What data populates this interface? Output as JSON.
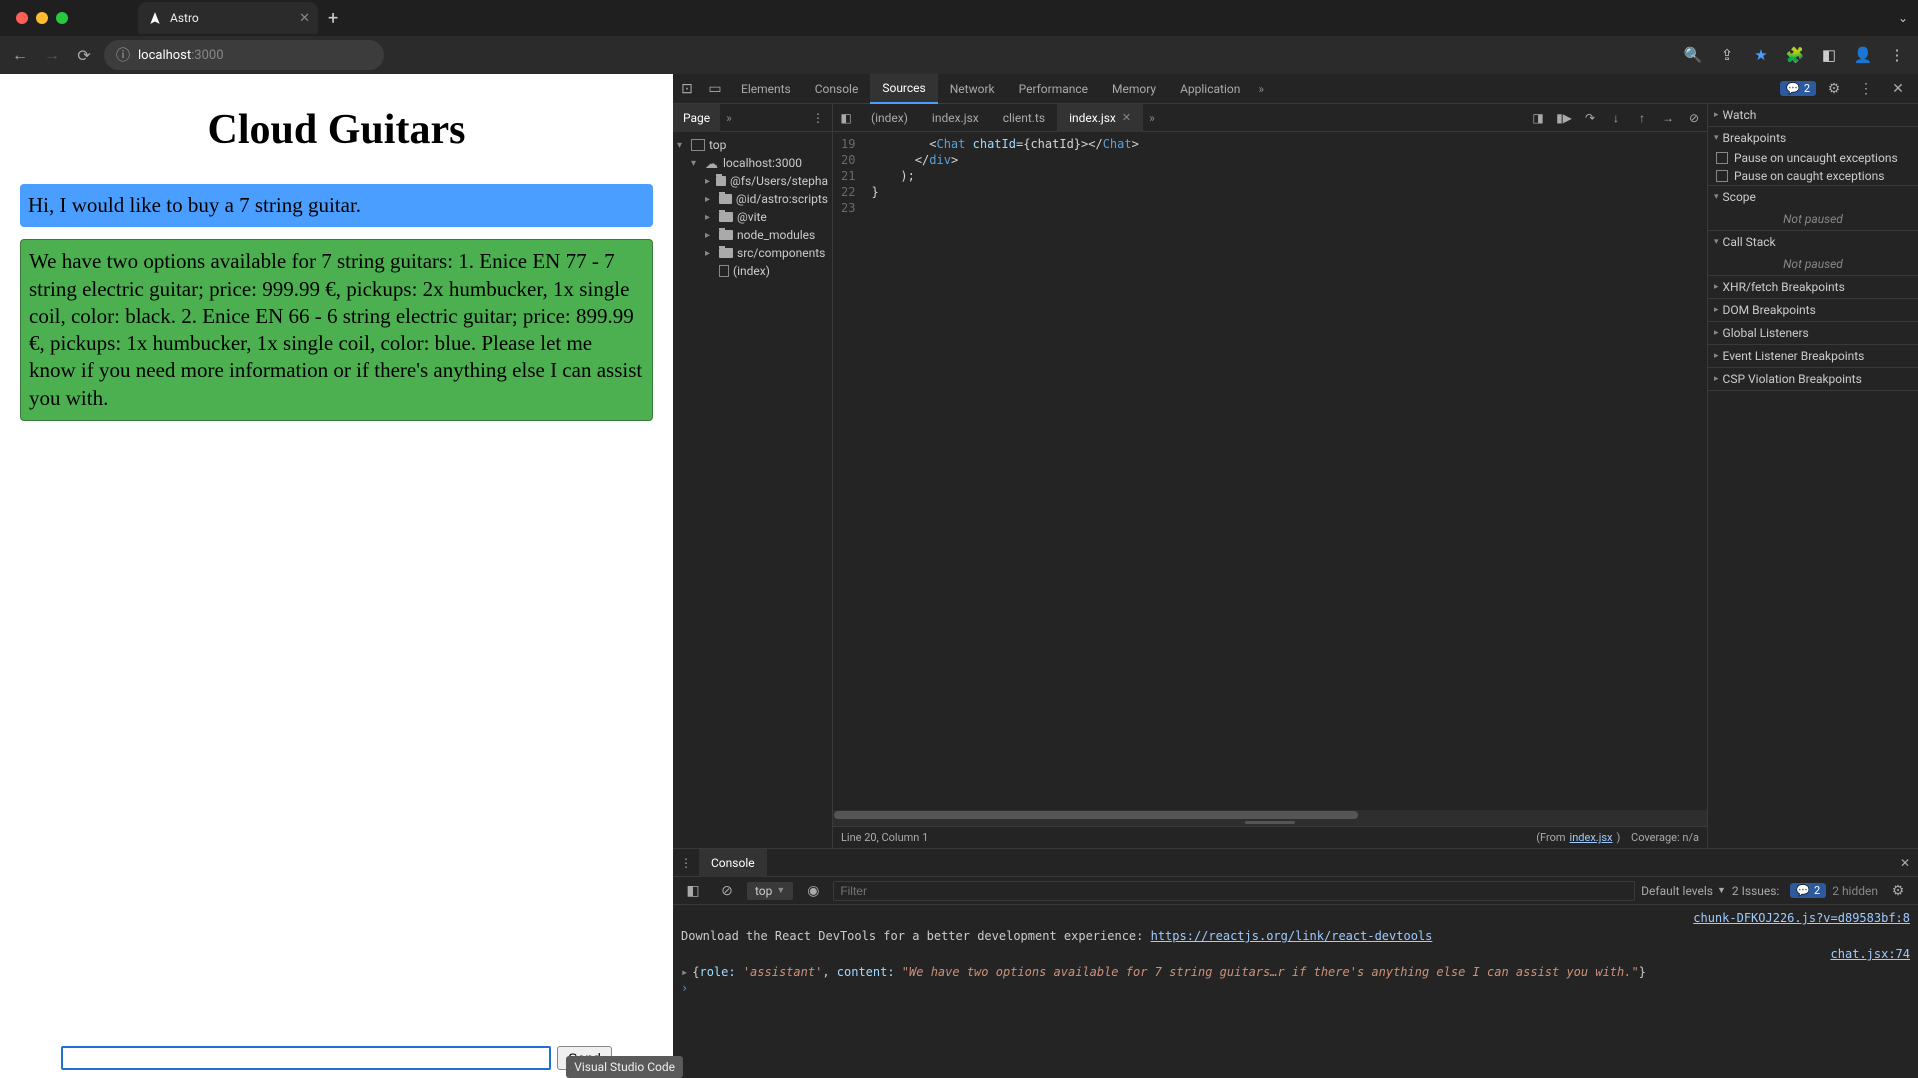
{
  "browser": {
    "tab_title": "Astro",
    "url_host": "localhost",
    "url_port": ":3000"
  },
  "page": {
    "heading": "Cloud Guitars",
    "messages": [
      {
        "role": "user",
        "text": "Hi, I would like to buy a 7 string guitar."
      },
      {
        "role": "assistant",
        "text": "We have two options available for 7 string guitars: 1. Enice EN 77 - 7 string electric guitar; price: 999.99 €, pickups: 2x humbucker, 1x single coil, color: black. 2. Enice EN 66 - 6 string electric guitar; price: 899.99 €, pickups: 1x humbucker, 1x single coil, color: blue. Please let me know if you need more information or if there's anything else I can assist you with."
      }
    ],
    "send_label": "Send",
    "tooltip": "Visual Studio Code"
  },
  "devtools": {
    "tabs": [
      "Elements",
      "Console",
      "Sources",
      "Network",
      "Performance",
      "Memory",
      "Application"
    ],
    "active_tab": "Sources",
    "issues_badge": "2",
    "sources": {
      "subtab": "Page",
      "tree": {
        "top": "top",
        "host": "localhost:3000",
        "folders": [
          "@fs/Users/stepha",
          "@id/astro:scripts",
          "@vite",
          "node_modules",
          "src/components"
        ],
        "file": "(index)"
      },
      "editor_tabs": [
        "(index)",
        "index.jsx",
        "client.ts",
        "index.jsx"
      ],
      "active_editor": "index.jsx",
      "line_numbers": [
        "19",
        "20",
        "21",
        "22",
        "23"
      ],
      "code_lines": [
        {
          "indent": "        ",
          "parts": [
            {
              "cls": "tk-text",
              "t": "<"
            },
            {
              "cls": "tk-tag",
              "t": "Chat"
            },
            {
              "cls": "tk-text",
              "t": " "
            },
            {
              "cls": "tk-attr",
              "t": "chatId"
            },
            {
              "cls": "tk-text",
              "t": "="
            },
            {
              "cls": "tk-brace",
              "t": "{chatId}"
            },
            {
              "cls": "tk-text",
              "t": "></"
            },
            {
              "cls": "tk-tag",
              "t": "Chat"
            },
            {
              "cls": "tk-text",
              "t": ">"
            }
          ]
        },
        {
          "indent": "      ",
          "parts": [
            {
              "cls": "tk-text",
              "t": "</"
            },
            {
              "cls": "tk-tag",
              "t": "div"
            },
            {
              "cls": "tk-text",
              "t": ">"
            }
          ]
        },
        {
          "indent": "    ",
          "parts": [
            {
              "cls": "tk-text",
              "t": ");"
            }
          ]
        },
        {
          "indent": "",
          "parts": [
            {
              "cls": "tk-text",
              "t": "}"
            }
          ]
        },
        {
          "indent": "",
          "parts": []
        }
      ],
      "status_left": "Line 20, Column 1",
      "status_from": "(From ",
      "status_file": "index.jsx",
      "status_close": ")",
      "status_cov": "Coverage: n/a"
    },
    "debugger": {
      "sections": [
        "Watch",
        "Breakpoints",
        "Scope",
        "Call Stack",
        "XHR/fetch Breakpoints",
        "DOM Breakpoints",
        "Global Listeners",
        "Event Listener Breakpoints",
        "CSP Violation Breakpoints"
      ],
      "bp_opts": [
        "Pause on uncaught exceptions",
        "Pause on caught exceptions"
      ],
      "not_paused": "Not paused"
    },
    "drawer": {
      "tab": "Console",
      "context": "top",
      "filter_placeholder": "Filter",
      "levels": "Default levels",
      "issues_label": "2 Issues:",
      "issues_count": "2",
      "hidden": "2 hidden",
      "source1": "chunk-DFKOJ226.js?v=d89583bf:8",
      "msg1_pre": "Download the React DevTools for a better development experience: ",
      "msg1_link": "https://reactjs.org/link/react-devtools",
      "source2": "chat.jsx:74",
      "obj_role_k": "role:",
      "obj_role_v": "'assistant'",
      "obj_content_k": "content:",
      "obj_content_v": "\"We have two options available for 7 string guitars…r if there's anything else I can assist you with.\""
    }
  }
}
